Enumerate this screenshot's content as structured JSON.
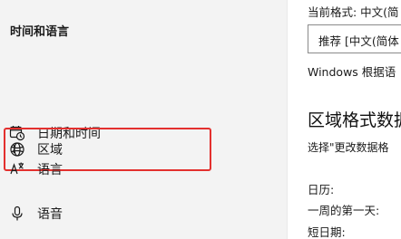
{
  "sidebar": {
    "title": "时间和语言",
    "items": [
      {
        "label": "日期和时间",
        "icon": "calendar-clock-icon",
        "selected": false
      },
      {
        "label": "区域",
        "icon": "globe-icon",
        "selected": true
      },
      {
        "label": "语言",
        "icon": "language-icon",
        "selected": false
      },
      {
        "label": "语音",
        "icon": "microphone-icon",
        "selected": false
      }
    ]
  },
  "content": {
    "current_format_label": "当前格式: 中文(简",
    "format_dropdown_value": "推荐 [中文(简体",
    "windows_note": "Windows 根据语",
    "section_title": "区域格式数据",
    "section_desc": "选择\"更改数据格",
    "fields": [
      "日历:",
      "一周的第一天:",
      "短日期:"
    ]
  },
  "colors": {
    "sidebar_bg": "#f3f3f3",
    "highlight_border": "#e3302e",
    "content_bg": "#ffffff"
  }
}
